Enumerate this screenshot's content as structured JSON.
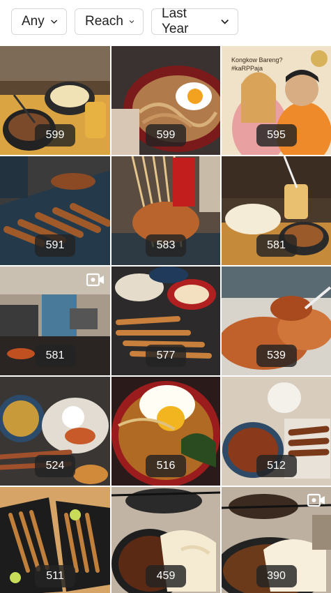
{
  "filters": {
    "type": {
      "label": "Any"
    },
    "metric": {
      "label": "Reach"
    },
    "period": {
      "label": "Last Year"
    }
  },
  "posts": [
    {
      "value": "599",
      "theme": "noodle-bowl-drink",
      "is_reel": false
    },
    {
      "value": "599",
      "theme": "noodle-fried-egg",
      "is_reel": false
    },
    {
      "value": "595",
      "theme": "people-poster",
      "is_reel": false,
      "poster_text": "Kongkow Bareng?",
      "poster_tag": "#kaRPPaja"
    },
    {
      "value": "591",
      "theme": "satay-platter",
      "is_reel": false
    },
    {
      "value": "583",
      "theme": "satay-skewers",
      "is_reel": false
    },
    {
      "value": "581",
      "theme": "crackers-drink",
      "is_reel": false
    },
    {
      "value": "581",
      "theme": "kitchen",
      "is_reel": true
    },
    {
      "value": "577",
      "theme": "satay-spread",
      "is_reel": false
    },
    {
      "value": "539",
      "theme": "fried-closeup",
      "is_reel": false
    },
    {
      "value": "524",
      "theme": "rice-spread",
      "is_reel": false
    },
    {
      "value": "516",
      "theme": "egg-soup",
      "is_reel": false
    },
    {
      "value": "512",
      "theme": "grill-bowl",
      "is_reel": false
    },
    {
      "value": "511",
      "theme": "satay-tray",
      "is_reel": false
    },
    {
      "value": "459",
      "theme": "crackers-bowl",
      "is_reel": false
    },
    {
      "value": "390",
      "theme": "chicken-crackers",
      "is_reel": true
    }
  ],
  "colors": {
    "badge_bg": "#232323",
    "chip_border": "#d7d7d7"
  }
}
